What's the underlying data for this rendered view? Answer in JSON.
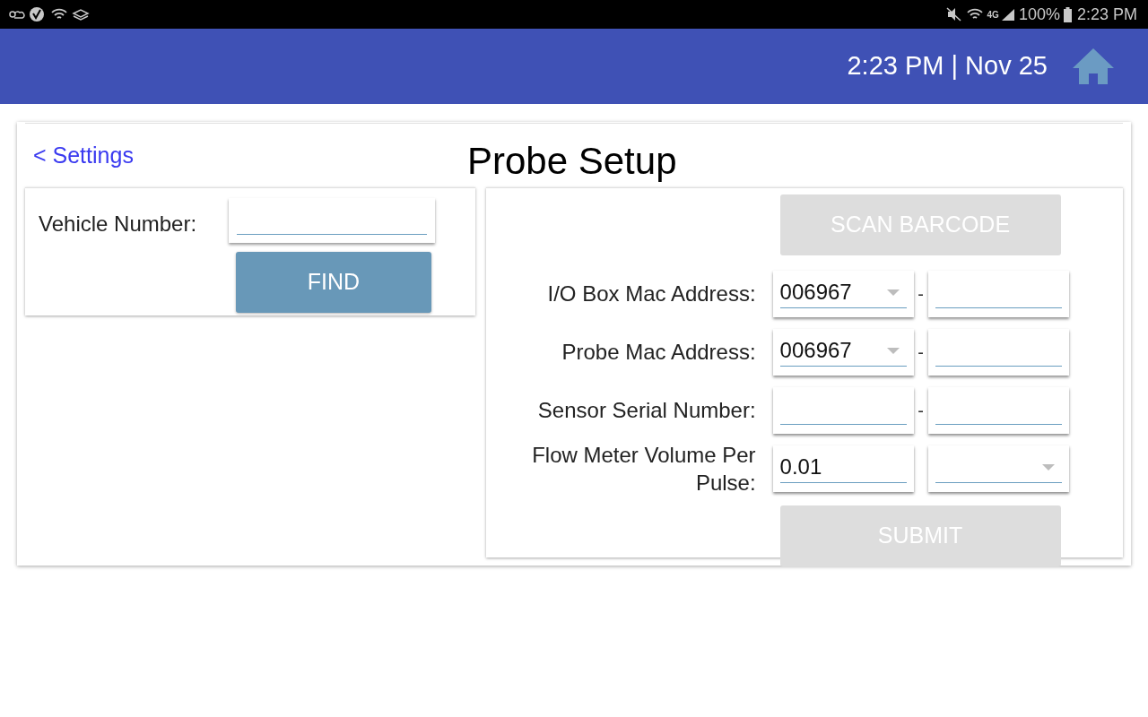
{
  "status_bar": {
    "network_label": "4G",
    "battery": "100%",
    "time": "2:23 PM"
  },
  "header": {
    "datetime": "2:23 PM | Nov 25"
  },
  "back_link": "< Settings",
  "title": "Probe Setup",
  "vehicle": {
    "label": "Vehicle Number:",
    "find_button": {
      "label": "FIND",
      "disabled": false
    }
  },
  "scan_button": {
    "label": "SCAN BARCODE",
    "disabled": true
  },
  "rows": [
    {
      "label": "I/O Box Mac Address:",
      "separator": "-",
      "fields": [
        {
          "kind": "select",
          "value": "006967"
        },
        {
          "kind": "text"
        }
      ]
    },
    {
      "label": "Probe Mac Address:",
      "separator": "-",
      "fields": [
        {
          "kind": "select",
          "value": "006967"
        },
        {
          "kind": "text"
        }
      ]
    },
    {
      "label": "Sensor Serial Number:",
      "separator": "-",
      "fields": [
        {
          "kind": "text"
        },
        {
          "kind": "text"
        }
      ]
    },
    {
      "label": "Flow Meter Volume Per Pulse:",
      "fields": [
        {
          "kind": "text",
          "value": "0.01"
        },
        {
          "kind": "select"
        }
      ]
    }
  ],
  "submit_button": {
    "label": "SUBMIT",
    "disabled": true
  }
}
